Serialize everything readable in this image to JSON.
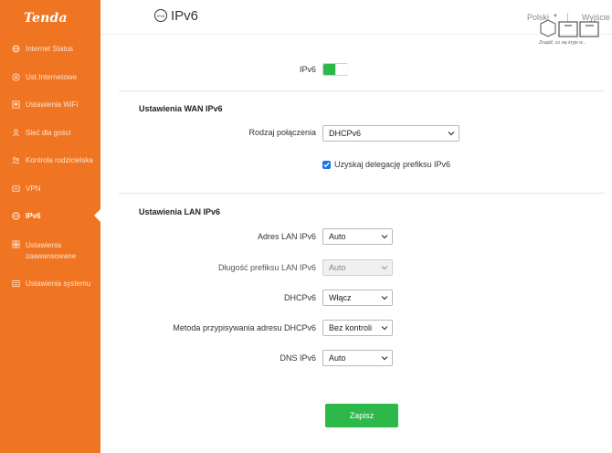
{
  "brand": {
    "logo_text": "Tenda"
  },
  "sidebar": {
    "items": [
      {
        "label": "Internet Status",
        "icon": "globe-icon"
      },
      {
        "label": "Ust.Internetowe",
        "icon": "globe-settings-icon"
      },
      {
        "label": "Ustawienia WiFi",
        "icon": "wifi-icon"
      },
      {
        "label": "Sieć dla gości",
        "icon": "guest-icon"
      },
      {
        "label": "Kontrola rodzicielska",
        "icon": "parental-icon"
      },
      {
        "label": "VPN",
        "icon": "vpn-icon"
      },
      {
        "label": "IPv6",
        "icon": "ipv6-icon",
        "active": true
      },
      {
        "label": "Ustawienia zaawansowane",
        "icon": "advanced-icon"
      },
      {
        "label": "Ustawienia systemu",
        "icon": "system-icon"
      }
    ]
  },
  "header": {
    "title": "IPv6",
    "title_icon_text": "IPv6",
    "language": "Polski",
    "logout": "Wyjście",
    "watermark_text": "Znajdź, co się kryje w..."
  },
  "ipv6": {
    "label": "IPv6",
    "enabled": true
  },
  "wan": {
    "section_title": "Ustawienia WAN IPv6",
    "connection_type_label": "Rodzaj połączenia",
    "connection_type_value": "DHCPv6",
    "prefix_delegation_label": "Uzyskaj delegację prefiksu IPv6",
    "prefix_delegation_checked": true
  },
  "lan": {
    "section_title": "Ustawienia LAN IPv6",
    "lan_address_label": "Adres LAN IPv6",
    "lan_address_value": "Auto",
    "prefix_length_label": "Długość prefiksu LAN IPv6",
    "prefix_length_value": "Auto",
    "dhcpv6_label": "DHCPv6",
    "dhcpv6_value": "Włącz",
    "assign_method_label": "Metoda przypisywania adresu DHCPv6",
    "assign_method_value": "Bez kontroli",
    "dns_label": "DNS IPv6",
    "dns_value": "Auto"
  },
  "actions": {
    "save_label": "Zapisz"
  },
  "colors": {
    "sidebar": "#f07522",
    "accent_green": "#2db84a",
    "checkbox_blue": "#1a73e8"
  }
}
